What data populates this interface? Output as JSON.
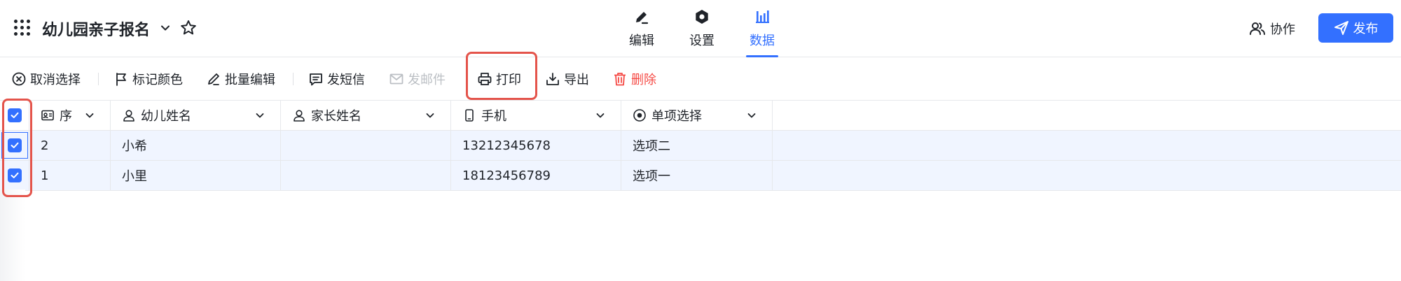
{
  "header": {
    "title": "幼儿园亲子报名",
    "tabs": [
      {
        "label": "编辑",
        "icon": "pen-icon",
        "active": false
      },
      {
        "label": "设置",
        "icon": "hexagon-gear-icon",
        "active": false
      },
      {
        "label": "数据",
        "icon": "bar-chart-icon",
        "active": true
      }
    ],
    "collab_label": "协作",
    "publish_label": "发布"
  },
  "toolbar": {
    "cancel_select": "取消选择",
    "mark_color": "标记颜色",
    "batch_edit": "批量编辑",
    "send_sms": "发短信",
    "send_email": "发邮件",
    "print": "打印",
    "export": "导出",
    "delete": "删除"
  },
  "table": {
    "columns": [
      {
        "label": "序",
        "icon": "id-card-icon"
      },
      {
        "label": "幼儿姓名",
        "icon": "person-icon"
      },
      {
        "label": "家长姓名",
        "icon": "person-icon"
      },
      {
        "label": "手机",
        "icon": "phone-icon"
      },
      {
        "label": "单项选择",
        "icon": "radio-icon"
      }
    ],
    "rows": [
      {
        "seq": "2",
        "child_name": "小希",
        "parent_name": "",
        "phone": "13212345678",
        "choice": "选项二",
        "checked": true
      },
      {
        "seq": "1",
        "child_name": "小里",
        "parent_name": "",
        "phone": "18123456789",
        "choice": "选项一",
        "checked": true
      }
    ],
    "header_checked": true
  },
  "colors": {
    "accent": "#3370ff",
    "danger": "#f54a45",
    "highlight": "#e4544b",
    "row_selected": "#f0f5ff"
  }
}
